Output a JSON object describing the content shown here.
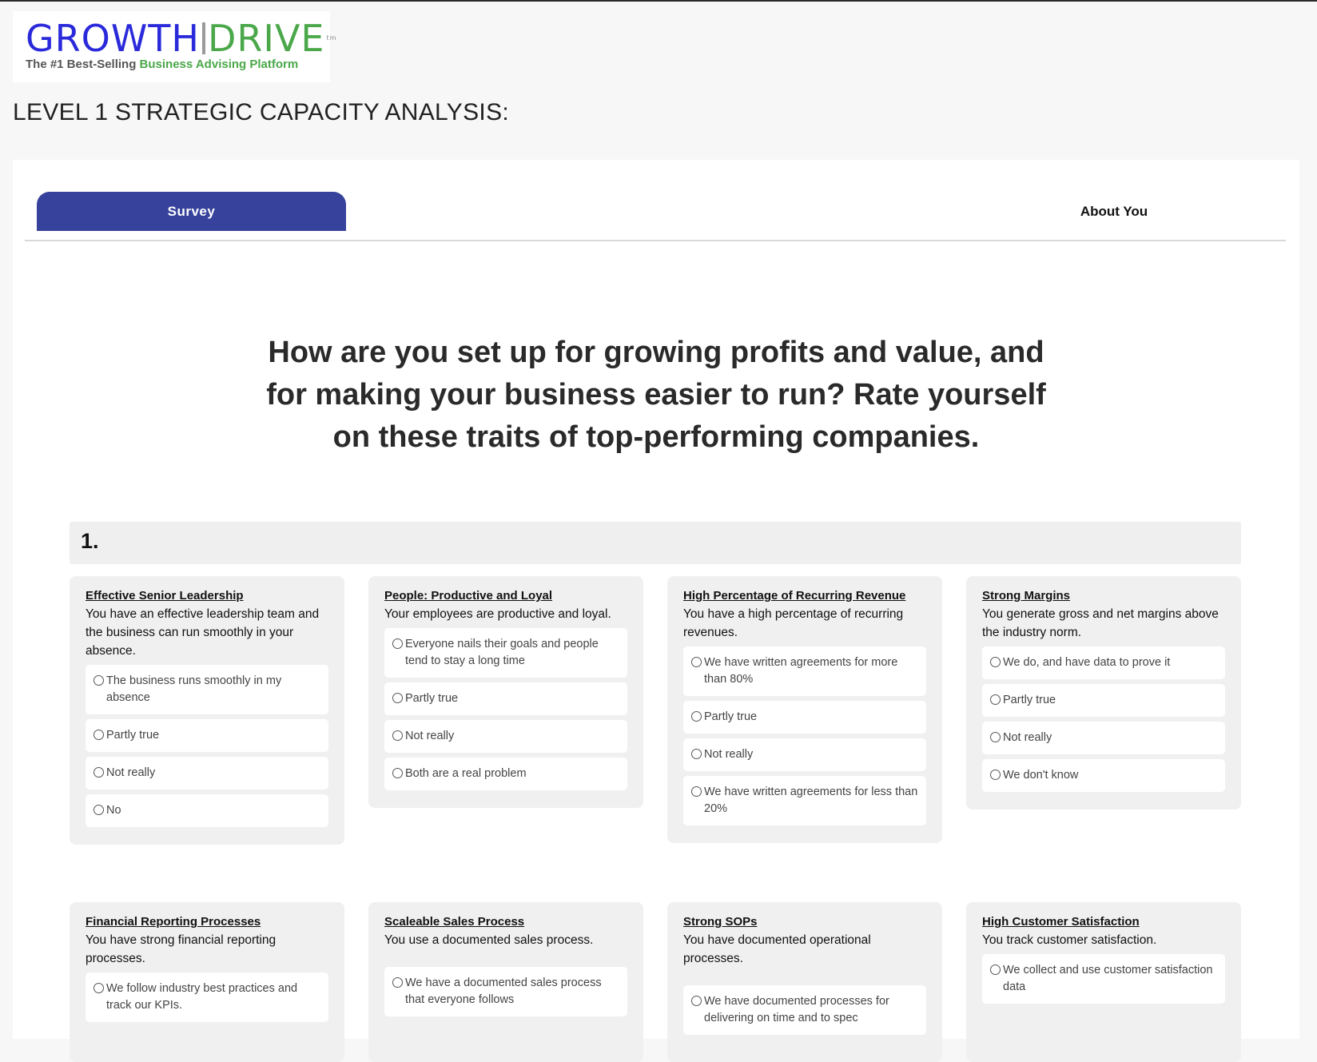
{
  "logo": {
    "word_left": "GROWTH",
    "word_right": "DRIVE",
    "tm": "tm",
    "tagline_start": "The #1 Best-Selling ",
    "tagline_highlight": "Business Advising Platform"
  },
  "page_title": "LEVEL 1 STRATEGIC CAPACITY ANALYSIS:",
  "tabs": [
    {
      "label": "Survey",
      "active": true
    },
    {
      "label": "About You",
      "active": false
    }
  ],
  "question": "How are you set up for growing profits and value, and for making your business easier to run? Rate yourself on these traits of top-performing companies.",
  "section_number": "1.",
  "colors": {
    "accent": "#36429b",
    "logo_blue": "#2a2adb",
    "logo_green": "#4aa84a"
  },
  "cards": [
    {
      "title": "Effective Senior Leadership",
      "description": "You have an effective leadership team and the business can run smoothly in your absence.",
      "options": [
        "The business runs smoothly in my absence",
        "Partly true",
        "Not really",
        "No"
      ]
    },
    {
      "title": "People: Productive and Loyal",
      "description": "Your employees are productive and loyal.",
      "options": [
        "Everyone nails their goals and people tend to stay a long time",
        "Partly true",
        "Not really",
        "Both are a real problem"
      ]
    },
    {
      "title": "High Percentage of Recurring Revenue",
      "description": "You have a high percentage of recurring revenues.",
      "options": [
        "We have written agreements for more than 80%",
        "Partly true",
        "Not really",
        "We have written agreements for less than 20%"
      ]
    },
    {
      "title": "Strong Margins",
      "description": "You generate gross and net margins above the industry norm.",
      "options": [
        "We do, and have data to prove it",
        "Partly true",
        "Not really",
        "We don't know"
      ]
    },
    {
      "title": "Financial Reporting Processes",
      "description": "You have strong financial reporting processes.",
      "options": [
        "We follow industry best practices and track our KPIs."
      ]
    },
    {
      "title": "Scaleable Sales Process",
      "description": "You use a documented sales process.",
      "options": [
        "We have a documented sales process that everyone follows"
      ]
    },
    {
      "title": "Strong SOPs",
      "description": "You have documented operational processes.",
      "options": [
        "We have documented processes for delivering on time and to spec"
      ]
    },
    {
      "title": "High Customer Satisfaction",
      "description": "You track customer satisfaction.",
      "options": [
        "We collect and use customer satisfaction data"
      ]
    }
  ]
}
